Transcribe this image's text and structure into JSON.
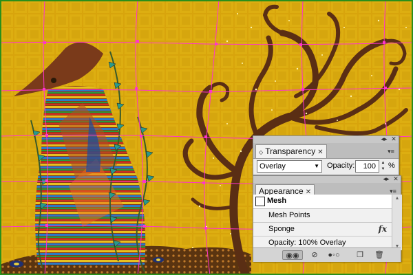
{
  "transparency_panel": {
    "tab_label": "Transparency",
    "tab_close": "✕",
    "blend_mode": "Overlay",
    "opacity_label": "Opacity:",
    "opacity_value": "100",
    "opacity_unit": "%"
  },
  "appearance_panel": {
    "tab_label": "Appearance",
    "tab_close": "✕",
    "object_type": "Mesh",
    "rows": [
      {
        "label": "Mesh Points"
      },
      {
        "label": "Sponge",
        "effect_badge": "fx"
      },
      {
        "label": "Opacity: 100% Overlay"
      }
    ],
    "fx_symbol": "fx"
  },
  "window_controls": {
    "collapse": "◂▸",
    "close": "✕",
    "panel_menu": "▾≡"
  },
  "icons": {
    "appearance_toolbar": [
      "new-art-maintains-appearance-icon",
      "clear-appearance-icon",
      "reduce-to-basic-appearance-icon",
      "duplicate-item-icon",
      "delete-item-icon"
    ]
  },
  "colors": {
    "canvas_gold": "#d9a80a",
    "mesh_magenta": "#ff33cc",
    "tentacle_brown": "#5a2e14",
    "panel_bg": "#ececec",
    "selection_green": "#2a8f1a"
  }
}
